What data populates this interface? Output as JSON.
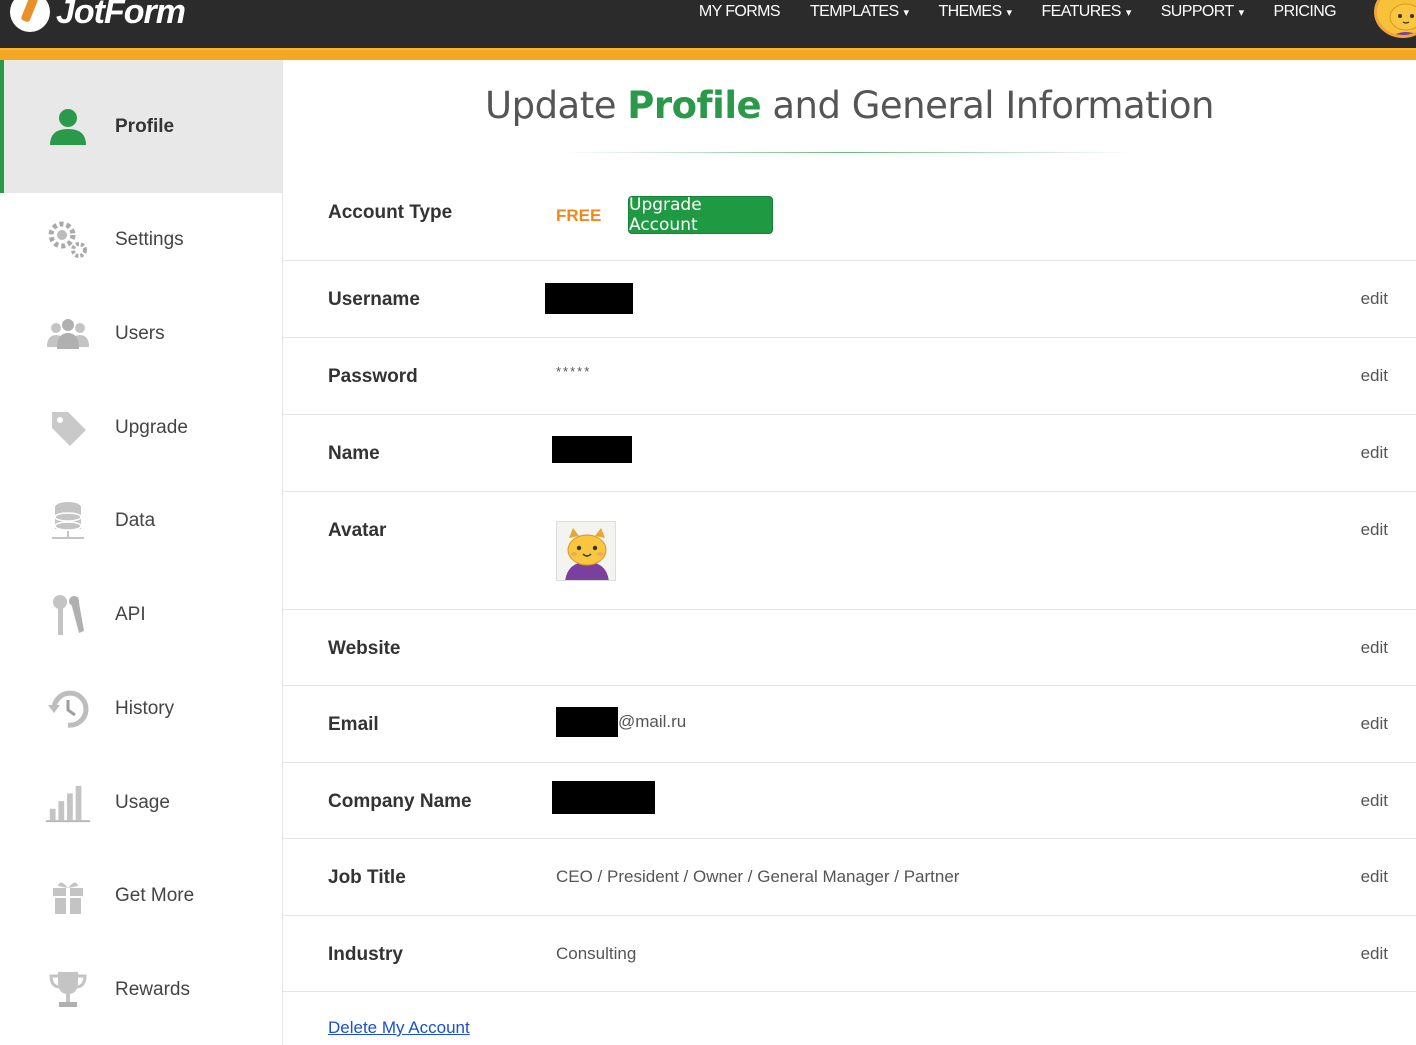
{
  "brand": {
    "name": "JotForm"
  },
  "nav": {
    "items": [
      {
        "label": "MY FORMS",
        "caret": false
      },
      {
        "label": "TEMPLATES",
        "caret": true
      },
      {
        "label": "THEMES",
        "caret": true
      },
      {
        "label": "FEATURES",
        "caret": true
      },
      {
        "label": "SUPPORT",
        "caret": true
      },
      {
        "label": "PRICING",
        "caret": false
      }
    ],
    "caret_glyph": "▾",
    "avatar_icon": "cat-avatar-icon"
  },
  "sidebar": {
    "items": [
      {
        "label": "Profile",
        "icon": "user-icon",
        "active": true
      },
      {
        "label": "Settings",
        "icon": "gear-icon",
        "active": false
      },
      {
        "label": "Users",
        "icon": "users-icon",
        "active": false
      },
      {
        "label": "Upgrade",
        "icon": "tag-icon",
        "active": false
      },
      {
        "label": "Data",
        "icon": "database-icon",
        "active": false
      },
      {
        "label": "API",
        "icon": "keys-icon",
        "active": false
      },
      {
        "label": "History",
        "icon": "history-icon",
        "active": false
      },
      {
        "label": "Usage",
        "icon": "bar-chart-icon",
        "active": false
      },
      {
        "label": "Get More",
        "icon": "gift-icon",
        "active": false
      },
      {
        "label": "Rewards",
        "icon": "trophy-icon",
        "active": false
      }
    ]
  },
  "header": {
    "title_before": "Update ",
    "title_highlight": "Profile",
    "title_after": " and General Information"
  },
  "profile": {
    "account_type": {
      "label": "Account Type",
      "value": "FREE",
      "button": "Upgrade Account"
    },
    "rows": {
      "username": {
        "label": "Username",
        "value": "",
        "edit": "edit"
      },
      "password": {
        "label": "Password",
        "value": "*****",
        "edit": "edit"
      },
      "name": {
        "label": "Name",
        "value": "",
        "edit": "edit"
      },
      "avatar": {
        "label": "Avatar",
        "edit": "edit"
      },
      "website": {
        "label": "Website",
        "value": "",
        "edit": "edit"
      },
      "email": {
        "label": "Email",
        "value": "@mail.ru",
        "edit": "edit"
      },
      "company": {
        "label": "Company Name",
        "value": "",
        "edit": "edit"
      },
      "job_title": {
        "label": "Job Title",
        "value": "CEO / President / Owner / General Manager / Partner",
        "edit": "edit"
      },
      "industry": {
        "label": "Industry",
        "value": "Consulting",
        "edit": "edit"
      }
    },
    "delete_link": "Delete My Account"
  },
  "colors": {
    "accent_green": "#2a9a4a",
    "free_orange": "#f0891d",
    "topbar": "#2b2b2b",
    "stripe": "#f5a623"
  }
}
